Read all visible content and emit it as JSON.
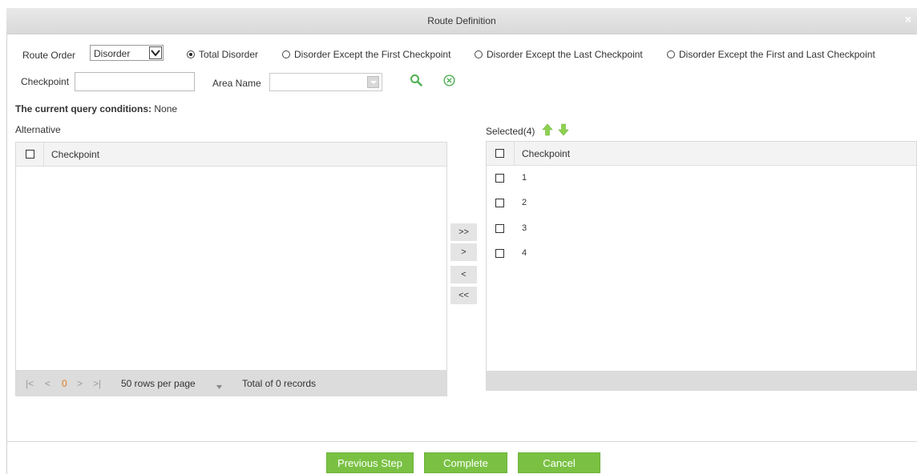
{
  "dialog": {
    "title": "Route Definition",
    "close_glyph": "×"
  },
  "route_order": {
    "label": "Route Order",
    "selected": "Disorder",
    "radios": [
      {
        "label": "Total Disorder",
        "checked": true
      },
      {
        "label": "Disorder Except the First Checkpoint",
        "checked": false
      },
      {
        "label": "Disorder Except the Last Checkpoint",
        "checked": false
      },
      {
        "label": "Disorder Except the First and Last Checkpoint",
        "checked": false
      }
    ]
  },
  "filters": {
    "checkpoint_label": "Checkpoint",
    "checkpoint_value": "",
    "area_label": "Area Name",
    "area_value": ""
  },
  "query": {
    "label": "The current query conditions:",
    "value": "None"
  },
  "alternative": {
    "title": "Alternative",
    "column": "Checkpoint",
    "pager": {
      "first": "|<",
      "prev": "<",
      "page": "0",
      "next": ">",
      "last": ">|",
      "rows_per_page": "50 rows per page",
      "total": "Total of 0 records"
    }
  },
  "selected": {
    "title": "Selected(4)",
    "column": "Checkpoint",
    "rows": [
      "1",
      "2",
      "3",
      "4"
    ]
  },
  "movers": [
    ">>",
    ">",
    "<",
    "<<"
  ],
  "buttons": {
    "previous": "Previous Step",
    "complete": "Complete",
    "cancel": "Cancel"
  },
  "colors": {
    "accent_green": "#7ac143",
    "icon_green": "#4caf50",
    "pager_current": "#e07b1c"
  },
  "icons": {
    "up": "arrow-up-icon",
    "down": "arrow-down-icon",
    "search": "search-icon",
    "clear": "clear-circle-icon"
  }
}
